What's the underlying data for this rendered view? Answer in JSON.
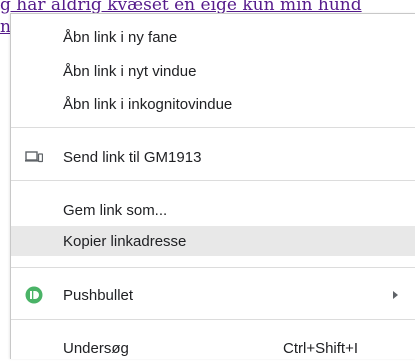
{
  "page": {
    "link_line_1": "g har aldrig kvæset en eige kun min hund",
    "link_line_2": "na"
  },
  "context_menu": {
    "items": [
      {
        "label": "Åbn link i ny fane"
      },
      {
        "label": "Åbn link i nyt vindue"
      },
      {
        "label": "Åbn link i inkognitovindue"
      },
      {
        "label": "Send link til GM1913",
        "icon": "devices-icon"
      },
      {
        "label": "Gem link som..."
      },
      {
        "label": "Kopier linkadresse",
        "highlighted": true
      },
      {
        "label": "Pushbullet",
        "icon": "pushbullet-icon",
        "has_submenu": true
      },
      {
        "label": "Undersøg",
        "shortcut": "Ctrl+Shift+I"
      }
    ]
  },
  "colors": {
    "link": "#551a8b",
    "highlight": "#e8e8e8",
    "pushbullet": "#4ab367",
    "text": "#202124"
  }
}
